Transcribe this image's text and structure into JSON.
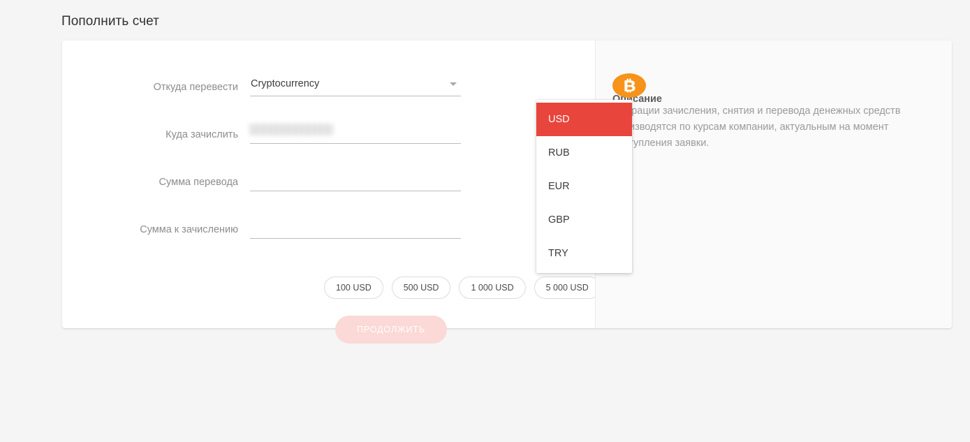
{
  "page": {
    "title": "Пополнить счет",
    "background_color": "#f5f5f5"
  },
  "form": {
    "rows": [
      {
        "label": "Откуда перевести",
        "type": "select",
        "value": "Cryptocurrency",
        "caret_icon": "chevron-down-icon"
      },
      {
        "label": "Куда зачислить",
        "type": "text",
        "value": "",
        "placeholder": "",
        "redacted": true
      },
      {
        "label": "Сумма перевода",
        "type": "text",
        "value": "",
        "placeholder": ""
      },
      {
        "label": "Сумма к зачислению",
        "type": "text",
        "value": "",
        "placeholder": ""
      }
    ],
    "quick_amounts": [
      "100 USD",
      "500 USD",
      "1 000 USD",
      "5 000 USD"
    ],
    "submit_label": "ПРОДОЛЖИТЬ"
  },
  "currency_dropdown": {
    "open": true,
    "selected": "USD",
    "highlight_color": "#e8453c",
    "options": [
      "USD",
      "RUB",
      "EUR",
      "GBP",
      "TRY"
    ]
  },
  "description": {
    "title": "Описание",
    "icon": "bitcoin-icon",
    "icon_color": "#f7931a",
    "text": "Операции зачисления, снятия и перевода денежных средств производятся по курсам компании, актуальным на момент поступления заявки."
  }
}
